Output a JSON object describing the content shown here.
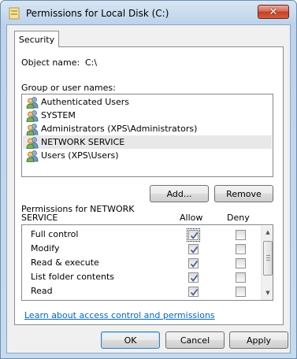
{
  "window": {
    "title": "Permissions for Local Disk (C:)",
    "close_label": "✕"
  },
  "tabs": [
    {
      "label": "Security"
    }
  ],
  "object": {
    "label": "Object name:",
    "value": "C:\\"
  },
  "group_list": {
    "label": "Group or user names:",
    "items": [
      {
        "label": "Authenticated Users",
        "selected": false
      },
      {
        "label": "SYSTEM",
        "selected": false
      },
      {
        "label": "Administrators (XPS\\Administrators)",
        "selected": false
      },
      {
        "label": "NETWORK SERVICE",
        "selected": true
      },
      {
        "label": "Users (XPS\\Users)",
        "selected": false
      }
    ]
  },
  "buttons": {
    "add": "Add...",
    "remove": "Remove",
    "ok": "OK",
    "cancel": "Cancel",
    "apply": "Apply"
  },
  "permissions": {
    "label_line1": "Permissions for NETWORK",
    "label_line2": "SERVICE",
    "allow_header": "Allow",
    "deny_header": "Deny",
    "rows": [
      {
        "name": "Full control",
        "allow": true,
        "deny": false
      },
      {
        "name": "Modify",
        "allow": true,
        "deny": false
      },
      {
        "name": "Read & execute",
        "allow": true,
        "deny": false
      },
      {
        "name": "List folder contents",
        "allow": true,
        "deny": false
      },
      {
        "name": "Read",
        "allow": true,
        "deny": false
      }
    ]
  },
  "link": {
    "text": "Learn about access control and permissions"
  },
  "colors": {
    "check": "#4a5f97",
    "link": "#0066cc",
    "selection": "#e8e8e8"
  }
}
